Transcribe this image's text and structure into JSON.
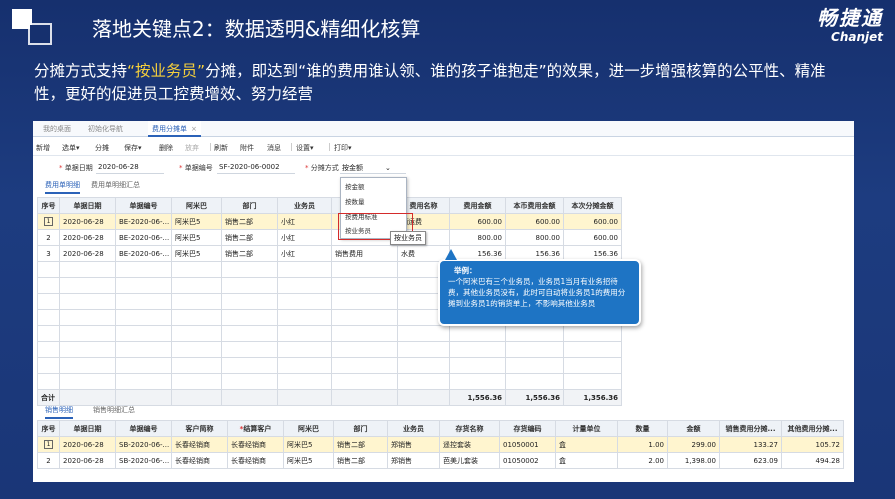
{
  "slide": {
    "title": "落地关键点2：数据透明&精细化核算",
    "brand_cn": "畅捷通",
    "brand_en": "Chanjet",
    "subtitle_pre": "分摊方式支持",
    "subtitle_highlight": "“按业务员”",
    "subtitle_post": "分摊，即达到“谁的费用谁认领、谁的孩子谁抱走”的效果，进一步增强核算的公平性、精准性，更好的促进员工控费增效、努力经营",
    "accent_color": "#f5cf3c"
  },
  "window": {
    "tabs": [
      {
        "label": "我的桌面"
      },
      {
        "label": "初始化导航"
      },
      {
        "label": "费用分摊单",
        "close": "×"
      }
    ],
    "toolbar": [
      {
        "label": "新增"
      },
      {
        "label": "选单",
        "caret": "▾"
      },
      {
        "label": "分摊"
      },
      {
        "label": "保存",
        "caret": "▾"
      },
      {
        "label": "删除"
      },
      {
        "label": "放弃"
      },
      {
        "label": "刷新"
      },
      {
        "label": "附件"
      },
      {
        "label": "消息"
      },
      {
        "label": "设置",
        "caret": "▾"
      },
      {
        "label": "打印",
        "caret": "▾"
      }
    ],
    "form": {
      "date_label": "单据日期",
      "date_value": "2020-06-28",
      "code_label": "单据编号",
      "code_value": "SF-2020-06-0002",
      "method_label": "分摊方式",
      "method_value": "按金额",
      "method_caret": "⌄"
    },
    "dropdown_options": [
      "按金额",
      "按数量",
      "按费用标准",
      "按业务员"
    ],
    "tooltip": "按业务员",
    "expense_tabs": [
      "费用单明细",
      "费用单明细汇总"
    ],
    "expense_table": {
      "columns": [
        "序号",
        "单据日期",
        "单据编号",
        "阿米巴",
        "部门",
        "业务员",
        "",
        "费用名称",
        "费用金额",
        "本币费用金额",
        "本次分摊金额"
      ],
      "rows": [
        [
          "1",
          "2020-06-28",
          "BE-2020-06-...",
          "阿米巴5",
          "销售二部",
          "小红",
          "",
          "销运费",
          "600.00",
          "600.00",
          "600.00"
        ],
        [
          "2",
          "2020-06-28",
          "BE-2020-06-...",
          "阿米巴5",
          "销售二部",
          "小红",
          "",
          "",
          "800.00",
          "800.00",
          "600.00"
        ],
        [
          "3",
          "2020-06-28",
          "BE-2020-06-...",
          "阿米巴5",
          "销售二部",
          "小红",
          "销售费用",
          "水费",
          "156.36",
          "156.36",
          "156.36"
        ]
      ],
      "total_label": "合计",
      "totals": [
        "1,556.36",
        "1,556.36",
        "1,356.36"
      ]
    },
    "callout": {
      "title": "举例：",
      "text": "一个阿米巴有三个业务员，业务员1当月有业务招待费，其他业务员没有，此时可自动将业务员1的费用分摊到业务员1的销货单上，不影响其他业务员"
    },
    "sales_tabs": [
      "销售明细",
      "销售明细汇总"
    ],
    "sales_table": {
      "columns": [
        "序号",
        "单据日期",
        "单据编号",
        "客户简称",
        "结算客户",
        "阿米巴",
        "部门",
        "业务员",
        "存货名称",
        "存货编码",
        "计量单位",
        "数量",
        "金额",
        "销售费用分摊...",
        "其他费用分摊..."
      ],
      "required_col": "结算客户",
      "rows": [
        [
          "1",
          "2020-06-28",
          "SB-2020-06-...",
          "长春经销商",
          "长春经销商",
          "阿米巴5",
          "销售二部",
          "郑销售",
          "遥控套装",
          "01050001",
          "盒",
          "1.00",
          "299.00",
          "133.27",
          "105.72"
        ],
        [
          "2",
          "2020-06-28",
          "SB-2020-06-...",
          "长春经销商",
          "长春经销商",
          "阿米巴5",
          "销售二部",
          "郑销售",
          "芭美儿套装",
          "01050002",
          "盒",
          "2.00",
          "1,398.00",
          "623.09",
          "494.28"
        ]
      ]
    }
  }
}
